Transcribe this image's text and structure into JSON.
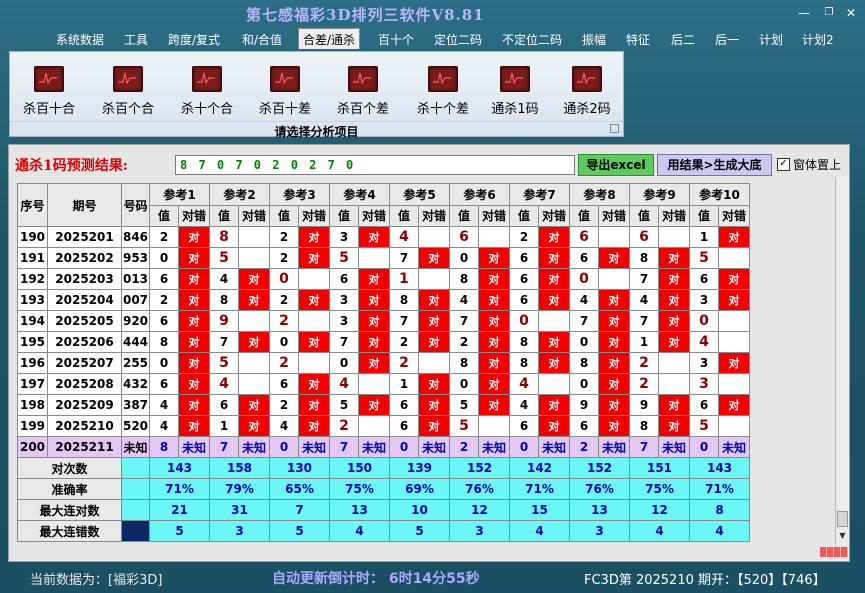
{
  "window": {
    "title": "第七感福彩3D排列三软件V8.81"
  },
  "menu": [
    {
      "label": "系统数据"
    },
    {
      "label": "工具"
    },
    {
      "label": "跨度/复式"
    },
    {
      "label": "和/合值"
    },
    {
      "label": "合差/通杀"
    },
    {
      "label": "百十个"
    },
    {
      "label": "定位二码"
    },
    {
      "label": "不定位二码"
    },
    {
      "label": "振幅"
    },
    {
      "label": "特征"
    },
    {
      "label": "后二"
    },
    {
      "label": "后一"
    },
    {
      "label": "计划"
    },
    {
      "label": "计划2"
    }
  ],
  "ribbon": {
    "buttons": [
      {
        "label": "杀百十合"
      },
      {
        "label": "杀百个合"
      },
      {
        "label": "杀十个合"
      },
      {
        "label": "杀百十差"
      },
      {
        "label": "杀百个差"
      },
      {
        "label": "杀十个差"
      },
      {
        "label": "通杀1码"
      },
      {
        "label": "通杀2码"
      }
    ],
    "caption": "请选择分析项目"
  },
  "result": {
    "label": "通杀1码预测结果:",
    "value": "8 7 0 7 0 2 0 2 7 0",
    "excel_button": "导出excel",
    "generate_button": "用结果>生成大底",
    "topmost_label": "窗体置上",
    "topmost_checked": "✓"
  },
  "table": {
    "headers": {
      "seq": "序号",
      "period": "期号",
      "code": "号码",
      "refs": [
        "参考1",
        "参考2",
        "参考3",
        "参考4",
        "参考5",
        "参考6",
        "参考7",
        "参考8",
        "参考9",
        "参考10"
      ],
      "sub_value": "值",
      "sub_result": "对错"
    },
    "rows": [
      {
        "seq": "190",
        "period": "2025201",
        "code": "846",
        "refs": [
          [
            "2",
            "对"
          ],
          [
            "8",
            ""
          ],
          [
            "2",
            "对"
          ],
          [
            "3",
            "对"
          ],
          [
            "4",
            ""
          ],
          [
            "6",
            ""
          ],
          [
            "2",
            "对"
          ],
          [
            "6",
            ""
          ],
          [
            "6",
            ""
          ],
          [
            "1",
            "对"
          ]
        ]
      },
      {
        "seq": "191",
        "period": "2025202",
        "code": "953",
        "refs": [
          [
            "0",
            "对"
          ],
          [
            "5",
            ""
          ],
          [
            "2",
            "对"
          ],
          [
            "5",
            ""
          ],
          [
            "7",
            "对"
          ],
          [
            "0",
            "对"
          ],
          [
            "6",
            "对"
          ],
          [
            "6",
            "对"
          ],
          [
            "8",
            "对"
          ],
          [
            "5",
            ""
          ]
        ]
      },
      {
        "seq": "192",
        "period": "2025203",
        "code": "013",
        "refs": [
          [
            "6",
            "对"
          ],
          [
            "4",
            "对"
          ],
          [
            "0",
            ""
          ],
          [
            "6",
            "对"
          ],
          [
            "1",
            ""
          ],
          [
            "8",
            "对"
          ],
          [
            "6",
            "对"
          ],
          [
            "0",
            ""
          ],
          [
            "7",
            "对"
          ],
          [
            "6",
            "对"
          ]
        ]
      },
      {
        "seq": "193",
        "period": "2025204",
        "code": "007",
        "refs": [
          [
            "2",
            "对"
          ],
          [
            "8",
            "对"
          ],
          [
            "2",
            "对"
          ],
          [
            "3",
            "对"
          ],
          [
            "8",
            "对"
          ],
          [
            "4",
            "对"
          ],
          [
            "6",
            "对"
          ],
          [
            "4",
            "对"
          ],
          [
            "4",
            "对"
          ],
          [
            "3",
            "对"
          ]
        ]
      },
      {
        "seq": "194",
        "period": "2025205",
        "code": "920",
        "refs": [
          [
            "6",
            "对"
          ],
          [
            "9",
            ""
          ],
          [
            "2",
            ""
          ],
          [
            "3",
            "对"
          ],
          [
            "7",
            "对"
          ],
          [
            "7",
            "对"
          ],
          [
            "0",
            ""
          ],
          [
            "7",
            "对"
          ],
          [
            "7",
            "对"
          ],
          [
            "0",
            ""
          ]
        ]
      },
      {
        "seq": "195",
        "period": "2025206",
        "code": "444",
        "refs": [
          [
            "8",
            "对"
          ],
          [
            "7",
            "对"
          ],
          [
            "0",
            "对"
          ],
          [
            "7",
            "对"
          ],
          [
            "2",
            "对"
          ],
          [
            "2",
            "对"
          ],
          [
            "8",
            "对"
          ],
          [
            "0",
            "对"
          ],
          [
            "1",
            "对"
          ],
          [
            "4",
            ""
          ]
        ]
      },
      {
        "seq": "196",
        "period": "2025207",
        "code": "255",
        "refs": [
          [
            "0",
            "对"
          ],
          [
            "5",
            ""
          ],
          [
            "2",
            ""
          ],
          [
            "0",
            "对"
          ],
          [
            "2",
            ""
          ],
          [
            "8",
            "对"
          ],
          [
            "8",
            "对"
          ],
          [
            "8",
            "对"
          ],
          [
            "2",
            ""
          ],
          [
            "3",
            "对"
          ]
        ]
      },
      {
        "seq": "197",
        "period": "2025208",
        "code": "432",
        "refs": [
          [
            "6",
            "对"
          ],
          [
            "4",
            ""
          ],
          [
            "6",
            "对"
          ],
          [
            "4",
            ""
          ],
          [
            "1",
            "对"
          ],
          [
            "0",
            "对"
          ],
          [
            "4",
            ""
          ],
          [
            "0",
            "对"
          ],
          [
            "2",
            ""
          ],
          [
            "3",
            ""
          ]
        ]
      },
      {
        "seq": "198",
        "period": "2025209",
        "code": "387",
        "refs": [
          [
            "4",
            "对"
          ],
          [
            "6",
            "对"
          ],
          [
            "2",
            "对"
          ],
          [
            "5",
            "对"
          ],
          [
            "6",
            "对"
          ],
          [
            "5",
            "对"
          ],
          [
            "4",
            "对"
          ],
          [
            "9",
            "对"
          ],
          [
            "9",
            "对"
          ],
          [
            "6",
            "对"
          ]
        ]
      },
      {
        "seq": "199",
        "period": "2025210",
        "code": "520",
        "refs": [
          [
            "4",
            "对"
          ],
          [
            "1",
            "对"
          ],
          [
            "4",
            "对"
          ],
          [
            "2",
            ""
          ],
          [
            "6",
            "对"
          ],
          [
            "5",
            ""
          ],
          [
            "6",
            "对"
          ],
          [
            "6",
            "对"
          ],
          [
            "8",
            "对"
          ],
          [
            "5",
            ""
          ]
        ]
      }
    ],
    "prediction": {
      "seq": "200",
      "period": "2025211",
      "code": "未知",
      "refs": [
        [
          "8",
          "未知"
        ],
        [
          "7",
          "未知"
        ],
        [
          "0",
          "未知"
        ],
        [
          "7",
          "未知"
        ],
        [
          "0",
          "未知"
        ],
        [
          "2",
          "未知"
        ],
        [
          "0",
          "未知"
        ],
        [
          "2",
          "未知"
        ],
        [
          "7",
          "未知"
        ],
        [
          "0",
          "未知"
        ]
      ]
    },
    "stats": [
      {
        "label": "对次数",
        "values": [
          "143",
          "158",
          "130",
          "150",
          "139",
          "152",
          "142",
          "152",
          "151",
          "143"
        ]
      },
      {
        "label": "准确率",
        "values": [
          "71%",
          "79%",
          "65%",
          "75%",
          "69%",
          "76%",
          "71%",
          "76%",
          "75%",
          "71%"
        ]
      },
      {
        "label": "最大连对数",
        "values": [
          "21",
          "31",
          "7",
          "13",
          "10",
          "12",
          "15",
          "13",
          "12",
          "8"
        ]
      },
      {
        "label": "最大连错数",
        "values": [
          "5",
          "3",
          "5",
          "4",
          "5",
          "3",
          "4",
          "3",
          "4",
          "4"
        ]
      }
    ]
  },
  "status": {
    "current_data": "当前数据为：[福彩3D]",
    "countdown": "自动更新倒计时：  6时14分55秒",
    "draw_info": "FC3D第 2025210 期开：【520】【746】"
  },
  "colors": {
    "hit": "#f20000",
    "prediction_row": "#e3c8f2",
    "stats_row": "#6cf7f7",
    "accent_title": "#b9b4ff"
  }
}
